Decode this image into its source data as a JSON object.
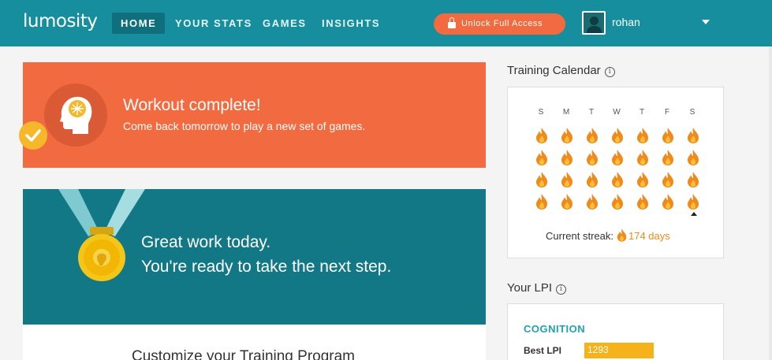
{
  "nav": {
    "logo": "lumosity",
    "items": [
      {
        "label": "HOME",
        "active": true
      },
      {
        "label": "YOUR STATS",
        "active": false
      },
      {
        "label": "GAMES",
        "active": false
      },
      {
        "label": "INSIGHTS",
        "active": false
      }
    ],
    "unlock_label": "Unlock Full Access",
    "username": "rohan"
  },
  "workout": {
    "title": "Workout complete!",
    "subtitle": "Come back tomorrow to play a new set of games."
  },
  "great_work": {
    "line1": "Great work today.",
    "line2": "You're ready to take the next step."
  },
  "customize": {
    "title": "Customize your Training Program"
  },
  "calendar": {
    "title": "Training Calendar",
    "days": [
      "S",
      "M",
      "T",
      "W",
      "T",
      "F",
      "S"
    ],
    "weeks_completed": 4,
    "streak_label": "Current streak:",
    "streak_value": "174 days"
  },
  "lpi": {
    "title": "Your LPI",
    "category": "COGNITION",
    "best_label": "Best LPI",
    "best_value": "1293"
  },
  "colors": {
    "nav_bg": "#168e9e",
    "accent_orange": "#f26b40",
    "teal_card": "#137885",
    "gold": "#f5b21b",
    "flame": "#f08a1c"
  }
}
